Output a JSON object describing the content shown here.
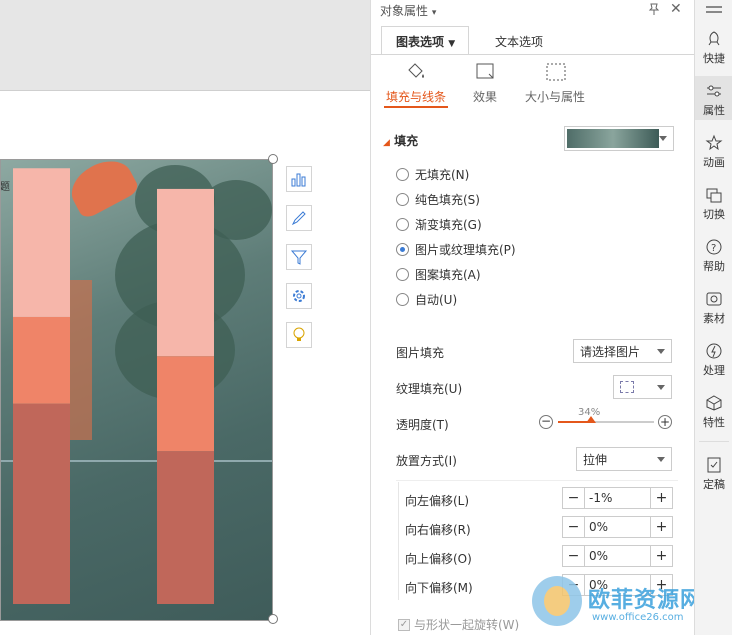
{
  "panel": {
    "title": "对象属性",
    "title_arrow": "▾",
    "tabs": [
      {
        "label": "图表选项"
      },
      {
        "label": "文本选项"
      }
    ],
    "subtabs": [
      {
        "label": "填充与线条"
      },
      {
        "label": "效果"
      },
      {
        "label": "大小与属性"
      }
    ],
    "fill_section": "填充",
    "fill_options": [
      {
        "label": "无填充(N)"
      },
      {
        "label": "纯色填充(S)"
      },
      {
        "label": "渐变填充(G)"
      },
      {
        "label": "图片或纹理填充(P)"
      },
      {
        "label": "图案填充(A)"
      },
      {
        "label": "自动(U)"
      }
    ],
    "picture_fill": {
      "label": "图片填充",
      "value": "请选择图片"
    },
    "texture_fill": {
      "label": "纹理填充(U)"
    },
    "transparency": {
      "label": "透明度(T)",
      "value": "34%",
      "level": 0.34
    },
    "placement": {
      "label": "放置方式(I)",
      "value": "拉伸"
    },
    "offsets": [
      {
        "label": "向左偏移(L)",
        "value": "-1%"
      },
      {
        "label": "向右偏移(R)",
        "value": "0%"
      },
      {
        "label": "向上偏移(O)",
        "value": "0%"
      },
      {
        "label": "向下偏移(M)",
        "value": "0%"
      }
    ],
    "rotate_with_shape": "与形状一起旋转(W)"
  },
  "rail": [
    {
      "label": "快捷"
    },
    {
      "label": "属性"
    },
    {
      "label": "动画"
    },
    {
      "label": "切换"
    },
    {
      "label": "帮助"
    },
    {
      "label": "素材"
    },
    {
      "label": "处理"
    },
    {
      "label": "特性"
    },
    {
      "label": "定稿"
    }
  ],
  "watermark": {
    "text": "欧菲资源网",
    "url": "www.office26.com"
  },
  "chart_data": {
    "type": "bar",
    "stacked": true,
    "categories": [
      "",
      ""
    ],
    "series": [
      {
        "values": [
          0.97,
          0.74
        ],
        "color": "#c0675a"
      },
      {
        "values": [
          0.42,
          0.46
        ],
        "color": "#ef8468"
      },
      {
        "values": [
          0.72,
          0.81
        ],
        "color": "#f6b6aa"
      }
    ],
    "ylim": [
      0,
      2.15
    ],
    "colors": {
      "s1": "#c0675a",
      "s2": "#ef8468",
      "s3": "#f6b6aa"
    }
  },
  "colors": {
    "accent": "#e4571b",
    "radio": "#3b7bd4"
  }
}
